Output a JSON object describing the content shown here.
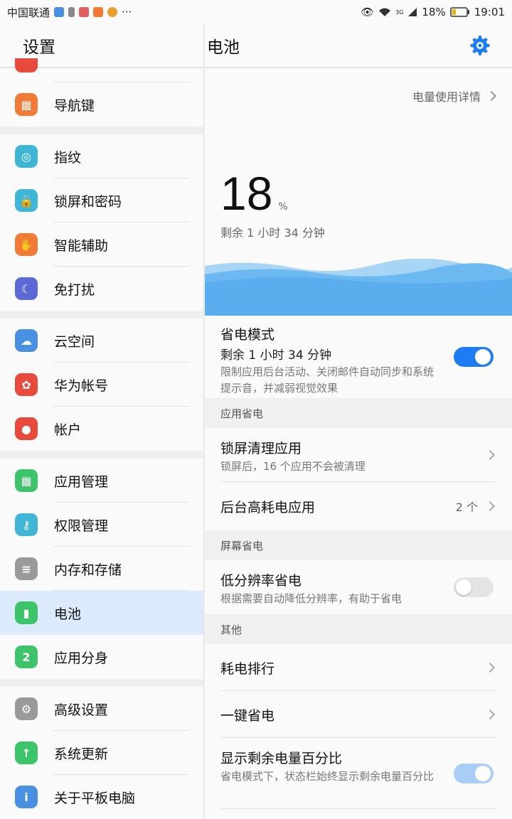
{
  "status": {
    "carrier": "中国联通",
    "dots": "···",
    "battery_pct": "18%",
    "time": "19:01",
    "net": "3G"
  },
  "left": {
    "title": "设置",
    "items": [
      {
        "label": "导航键",
        "color": "#f07a36",
        "icon": "navigation-key-icon"
      },
      {
        "label": "指纹",
        "color": "#3fb6d6",
        "icon": "fingerprint-icon"
      },
      {
        "label": "锁屏和密码",
        "color": "#3fb6d6",
        "icon": "lock-icon"
      },
      {
        "label": "智能辅助",
        "color": "#f07a36",
        "icon": "hand-icon"
      },
      {
        "label": "免打扰",
        "color": "#5b6ad4",
        "icon": "moon-icon"
      },
      {
        "label": "云空间",
        "color": "#4a90e2",
        "icon": "cloud-icon"
      },
      {
        "label": "华为帐号",
        "color": "#e84a3c",
        "icon": "huawei-icon"
      },
      {
        "label": "帐户",
        "color": "#e84a3c",
        "icon": "account-icon"
      },
      {
        "label": "应用管理",
        "color": "#3cc46a",
        "icon": "apps-icon"
      },
      {
        "label": "权限管理",
        "color": "#3fb6d6",
        "icon": "key-icon"
      },
      {
        "label": "内存和存储",
        "color": "#9a9a9a",
        "icon": "storage-icon"
      },
      {
        "label": "电池",
        "color": "#3cc46a",
        "icon": "battery-icon"
      },
      {
        "label": "应用分身",
        "color": "#3cc46a",
        "icon": "app-twin-icon"
      },
      {
        "label": "高级设置",
        "color": "#9a9a9a",
        "icon": "advanced-gear-icon"
      },
      {
        "label": "系统更新",
        "color": "#3cc46a",
        "icon": "update-icon"
      },
      {
        "label": "关于平板电脑",
        "color": "#4a90e2",
        "icon": "info-icon"
      }
    ]
  },
  "right": {
    "title": "电池",
    "detail_link": "电量使用详情",
    "percent": "18",
    "percent_unit": "%",
    "remaining": "剩余 1 小时 34 分钟",
    "power_saving": {
      "title": "省电模式",
      "subtitle": "剩余 1 小时 34 分钟",
      "desc": "限制应用后台活动、关闭邮件自动同步和系统提示音，并减弱视觉效果",
      "on": true
    },
    "sect_app": "应用省电",
    "lock_clean": {
      "title": "锁屏清理应用",
      "desc": "锁屏后，16 个应用不会被清理"
    },
    "bg_high": {
      "title": "后台高耗电应用",
      "count": "2 个"
    },
    "sect_screen": "屏幕省电",
    "low_res": {
      "title": "低分辨率省电",
      "desc": "根据需要自动降低分辨率，有助于省电",
      "on": false
    },
    "sect_other": "其他",
    "ranking": "耗电排行",
    "one_key": "一键省电",
    "show_pct": {
      "title": "显示剩余电量百分比",
      "desc": "省电模式下，状态栏始终显示剩余电量百分比",
      "on": true
    },
    "accent": "#1d7cf2"
  }
}
